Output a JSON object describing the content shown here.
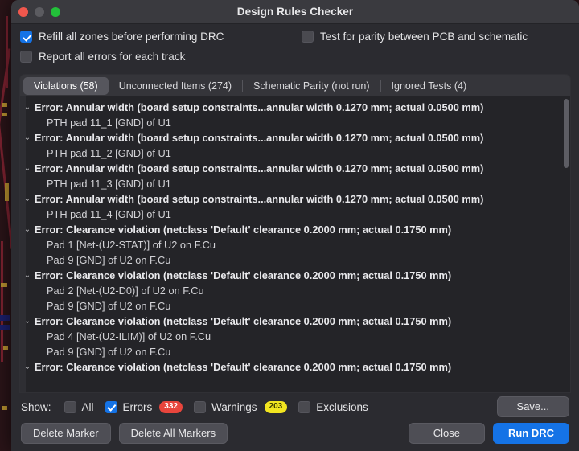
{
  "window": {
    "title": "Design Rules Checker",
    "traffic_lights": [
      "close-button",
      "minimize-button",
      "maximize-button"
    ]
  },
  "options": [
    {
      "label": "Refill all zones before performing DRC",
      "checked": true,
      "name": "refill-zones-checkbox"
    },
    {
      "label": "Report all errors for each track",
      "checked": false,
      "name": "report-all-errors-checkbox"
    },
    {
      "label": "Test for parity between PCB and schematic",
      "checked": false,
      "name": "test-parity-checkbox"
    }
  ],
  "tabs": [
    {
      "label": "Violations (58)",
      "active": true
    },
    {
      "label": "Unconnected Items (274)",
      "active": false
    },
    {
      "label": "Schematic Parity (not run)",
      "active": false
    },
    {
      "label": "Ignored Tests (4)",
      "active": false
    }
  ],
  "violations": [
    {
      "type": "parent",
      "text": "Error: Annular width (board setup constraints...annular width 0.1270 mm; actual 0.0500 mm)"
    },
    {
      "type": "child",
      "text": "PTH pad 11_1 [GND] of U1"
    },
    {
      "type": "parent",
      "text": "Error: Annular width (board setup constraints...annular width 0.1270 mm; actual 0.0500 mm)"
    },
    {
      "type": "child",
      "text": "PTH pad 11_2 [GND] of U1"
    },
    {
      "type": "parent",
      "text": "Error: Annular width (board setup constraints...annular width 0.1270 mm; actual 0.0500 mm)"
    },
    {
      "type": "child",
      "text": "PTH pad 11_3 [GND] of U1"
    },
    {
      "type": "parent",
      "text": "Error: Annular width (board setup constraints...annular width 0.1270 mm; actual 0.0500 mm)"
    },
    {
      "type": "child",
      "text": "PTH pad 11_4 [GND] of U1"
    },
    {
      "type": "parent",
      "text": "Error: Clearance violation (netclass 'Default' clearance 0.2000 mm; actual 0.1750 mm)"
    },
    {
      "type": "child",
      "text": "Pad 1 [Net-(U2-STAT)] of U2 on F.Cu"
    },
    {
      "type": "child",
      "text": "Pad 9 [GND] of U2 on F.Cu"
    },
    {
      "type": "parent",
      "text": "Error: Clearance violation (netclass 'Default' clearance 0.2000 mm; actual 0.1750 mm)"
    },
    {
      "type": "child",
      "text": "Pad 2 [Net-(U2-D0)] of U2 on F.Cu"
    },
    {
      "type": "child",
      "text": "Pad 9 [GND] of U2 on F.Cu"
    },
    {
      "type": "parent",
      "text": "Error: Clearance violation (netclass 'Default' clearance 0.2000 mm; actual 0.1750 mm)"
    },
    {
      "type": "child",
      "text": "Pad 4 [Net-(U2-ILIM)] of U2 on F.Cu"
    },
    {
      "type": "child",
      "text": "Pad 9 [GND] of U2 on F.Cu"
    },
    {
      "type": "parent",
      "text": "Error: Clearance violation (netclass 'Default' clearance 0.2000 mm; actual 0.1750 mm)"
    }
  ],
  "footer": {
    "show_label": "Show:",
    "filters": [
      {
        "label": "All",
        "checked": false,
        "badge": null,
        "badge_color": null
      },
      {
        "label": "Errors",
        "checked": true,
        "badge": "332",
        "badge_color": "#e8453c"
      },
      {
        "label": "Warnings",
        "checked": false,
        "badge": "203",
        "badge_color": "#f2e520"
      },
      {
        "label": "Exclusions",
        "checked": false,
        "badge": null,
        "badge_color": null
      }
    ],
    "save_label": "Save...",
    "delete_marker_label": "Delete Marker",
    "delete_all_markers_label": "Delete All Markers",
    "close_label": "Close",
    "run_drc_label": "Run DRC"
  },
  "colors": {
    "accent": "#1573e6",
    "error_badge": "#e8453c",
    "warning_badge": "#f2e520",
    "window_bg": "#2b2b30",
    "list_bg": "#242428"
  }
}
